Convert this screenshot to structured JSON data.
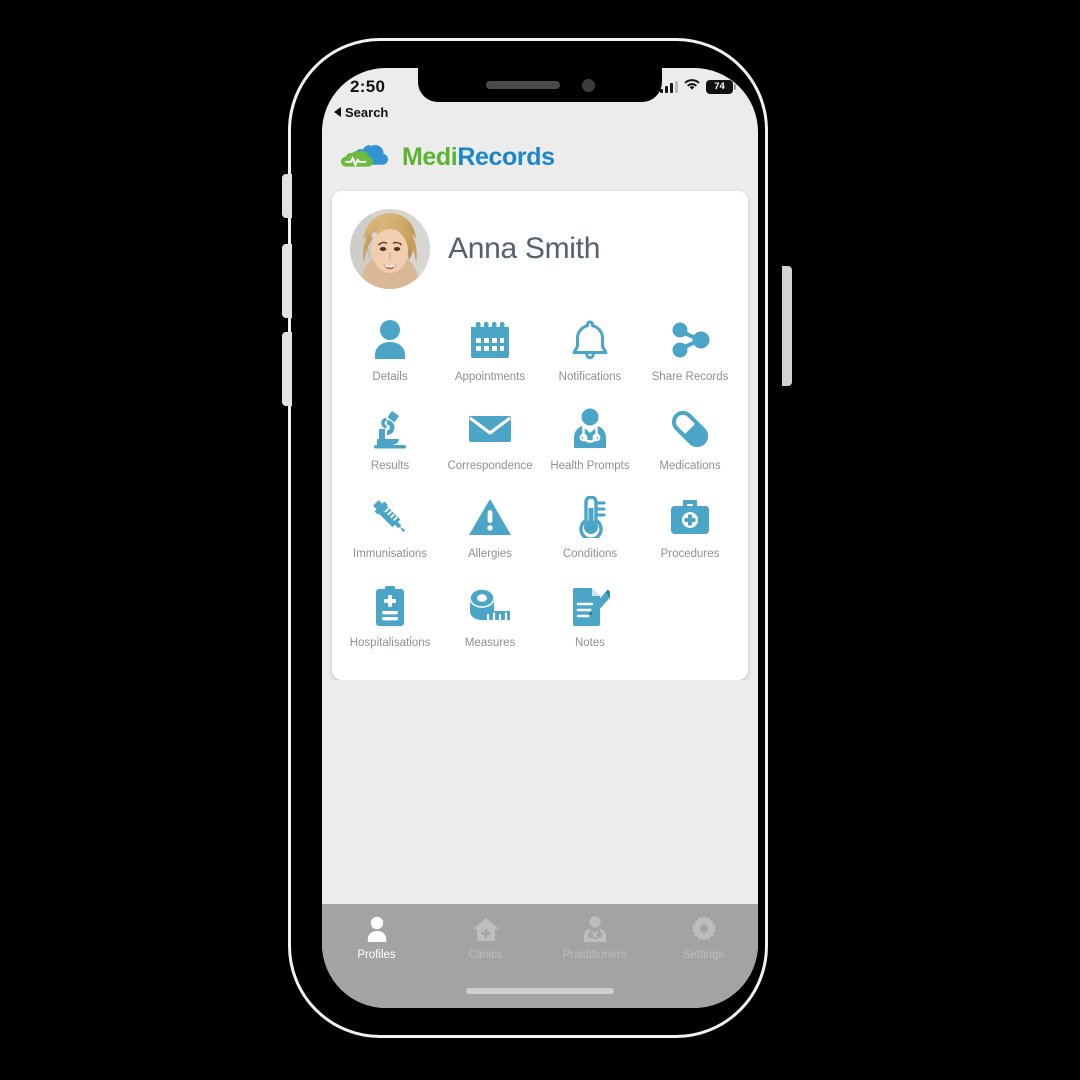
{
  "status_bar": {
    "time": "2:50",
    "back_label": "Search",
    "battery_percent": "74",
    "signal_icon": "cellular-signal-icon",
    "wifi_icon": "wifi-icon",
    "battery_icon": "battery-icon"
  },
  "brand": {
    "logo_icon": "medirecords-cloud-logo-icon",
    "name_part1": "Medi",
    "name_part2": "Records",
    "color_green": "#5cb332",
    "color_blue": "#1b87c9"
  },
  "patient": {
    "name": "Anna Smith",
    "avatar_icon": "patient-avatar"
  },
  "theme": {
    "icon_blue": "#4ba5c7",
    "label_grey": "#8e9092",
    "page_background": "#ececec",
    "tabbar_grey": "#a3a3a3"
  },
  "tiles": [
    {
      "label": "Details",
      "icon": "person-icon"
    },
    {
      "label": "Appointments",
      "icon": "calendar-icon"
    },
    {
      "label": "Notifications",
      "icon": "bell-icon"
    },
    {
      "label": "Share Records",
      "icon": "share-nodes-icon"
    },
    {
      "label": "Results",
      "icon": "microscope-icon"
    },
    {
      "label": "Correspondence",
      "icon": "envelope-icon"
    },
    {
      "label": "Health Prompts",
      "icon": "doctor-stethoscope-icon"
    },
    {
      "label": "Medications",
      "icon": "pill-capsule-icon"
    },
    {
      "label": "Immunisations",
      "icon": "syringe-icon"
    },
    {
      "label": "Allergies",
      "icon": "warning-triangle-icon"
    },
    {
      "label": "Conditions",
      "icon": "thermometer-icon"
    },
    {
      "label": "Procedures",
      "icon": "medical-bag-icon"
    },
    {
      "label": "Hospitalisations",
      "icon": "clipboard-plus-icon"
    },
    {
      "label": "Measures",
      "icon": "measuring-tape-icon"
    },
    {
      "label": "Notes",
      "icon": "note-pencil-icon"
    }
  ],
  "tabbar": {
    "items": [
      {
        "label": "Profiles",
        "icon": "profiles-person-icon",
        "active": true
      },
      {
        "label": "Clinics",
        "icon": "clinic-house-icon",
        "active": false
      },
      {
        "label": "Practitioners",
        "icon": "practitioner-icon",
        "active": false
      },
      {
        "label": "Settings",
        "icon": "gear-icon",
        "active": false
      }
    ]
  }
}
